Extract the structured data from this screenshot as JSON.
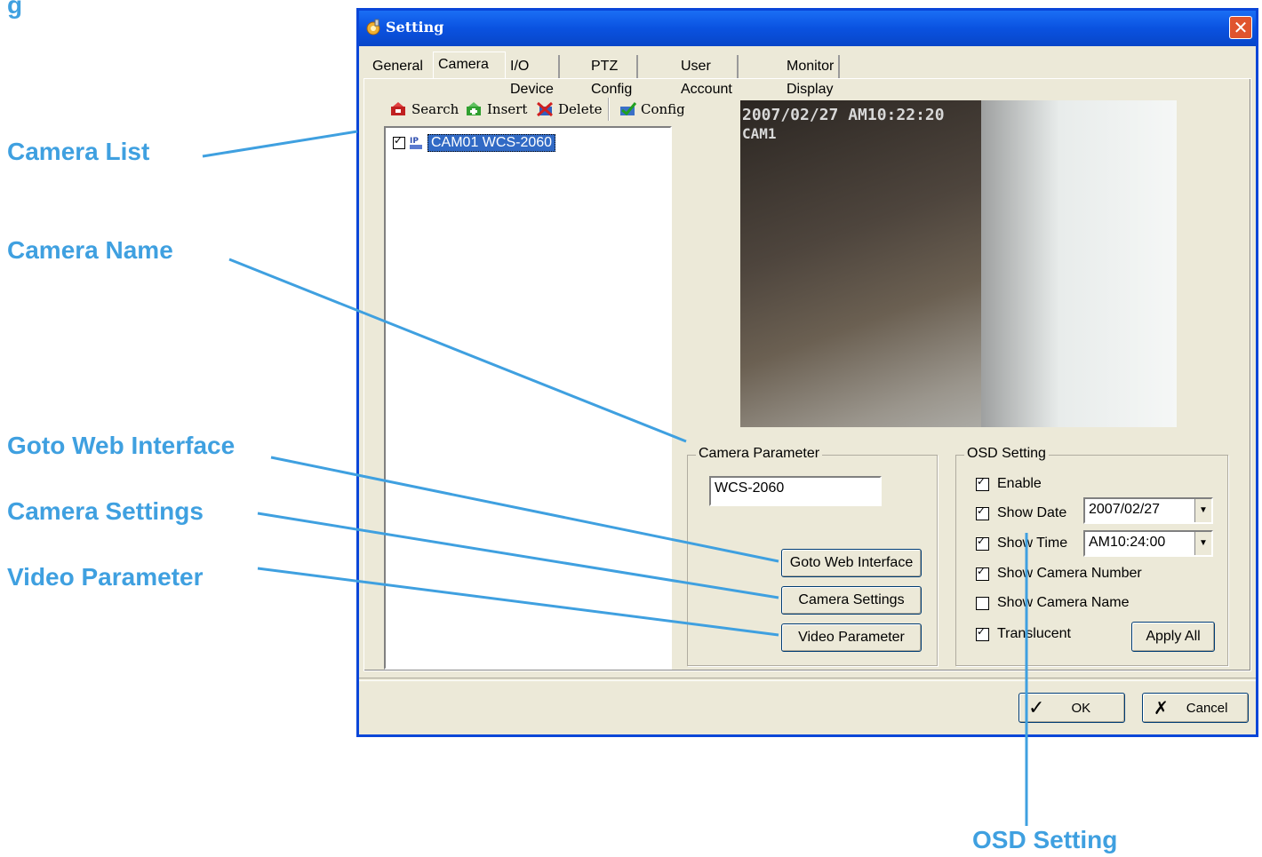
{
  "callouts": {
    "top_partial": "g",
    "camera_list": "Camera List",
    "camera_name": "Camera Name",
    "goto_web": "Goto Web Interface",
    "camera_settings": "Camera Settings",
    "video_parameter": "Video Parameter",
    "osd_setting": "OSD Setting"
  },
  "window": {
    "title": "Setting",
    "close_icon": "close-icon"
  },
  "tabs": [
    "General",
    "Camera",
    "I/O Device",
    "PTZ Config",
    "User Account",
    "Monitor Display"
  ],
  "active_tab": "Camera",
  "toolbar": {
    "search": "Search",
    "insert": "Insert",
    "delete": "Delete",
    "config": "Config"
  },
  "camera_list": {
    "items": [
      {
        "label": "CAM01 WCS-2060",
        "checked": true,
        "icon": "ip-camera-icon"
      }
    ]
  },
  "video": {
    "osd_datetime": "2007/02/27 AM10:22:20",
    "osd_camera": "CAM1"
  },
  "camera_parameter": {
    "title": "Camera Parameter",
    "name_value": "WCS-2060",
    "goto_web_label": "Goto Web Interface",
    "camera_settings_label": "Camera Settings",
    "video_parameter_label": "Video Parameter"
  },
  "osd_setting": {
    "title": "OSD Setting",
    "enable": {
      "label": "Enable",
      "checked": true
    },
    "show_date": {
      "label": "Show Date",
      "checked": true,
      "value": "2007/02/27"
    },
    "show_time": {
      "label": "Show Time",
      "checked": true,
      "value": "AM10:24:00"
    },
    "show_camera_number": {
      "label": "Show Camera Number",
      "checked": true
    },
    "show_camera_name": {
      "label": "Show Camera Name",
      "checked": false
    },
    "translucent": {
      "label": "Translucent",
      "checked": true
    },
    "apply_all_label": "Apply All"
  },
  "footer": {
    "ok_label": "OK",
    "cancel_label": "Cancel"
  },
  "colors": {
    "callout": "#3fa0e0",
    "titlebar": "#0a52e0",
    "dialog_bg": "#ece9d8",
    "selection": "#316ac5"
  }
}
